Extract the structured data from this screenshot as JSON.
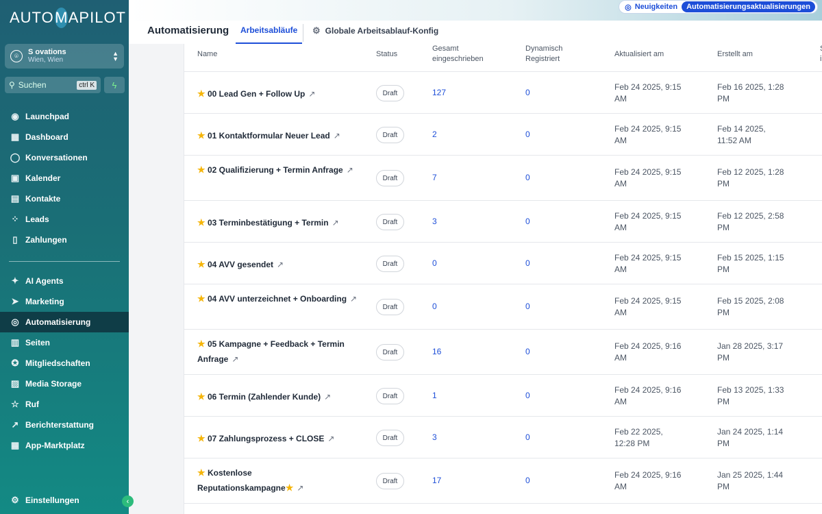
{
  "brand": {
    "logo_left": "AUTO",
    "logo_m": "M",
    "logo_right": "APILOT"
  },
  "account": {
    "name": "S          ovations",
    "sub": "Wien, Wien"
  },
  "search": {
    "placeholder": "Suchen",
    "shortcut": "ctrl K"
  },
  "sidebar": {
    "items": [
      {
        "label": "Launchpad",
        "icon": "rocket-icon",
        "glyph": "◉"
      },
      {
        "label": "Dashboard",
        "icon": "dashboard-icon",
        "glyph": "▦"
      },
      {
        "label": "Konversationen",
        "icon": "chat-icon",
        "glyph": "◯"
      },
      {
        "label": "Kalender",
        "icon": "calendar-icon",
        "glyph": "▣"
      },
      {
        "label": "Kontakte",
        "icon": "contacts-icon",
        "glyph": "▤"
      },
      {
        "label": "Leads",
        "icon": "leads-icon",
        "glyph": "⁘"
      },
      {
        "label": "Zahlungen",
        "icon": "payments-icon",
        "glyph": "▯"
      }
    ],
    "items2": [
      {
        "label": "AI Agents",
        "icon": "sparkles-icon",
        "glyph": "✦"
      },
      {
        "label": "Marketing",
        "icon": "send-icon",
        "glyph": "➤"
      },
      {
        "label": "Automatisierung",
        "icon": "automation-icon",
        "glyph": "◎"
      },
      {
        "label": "Seiten",
        "icon": "pages-icon",
        "glyph": "▥"
      },
      {
        "label": "Mitgliedschaften",
        "icon": "badge-icon",
        "glyph": "✪"
      },
      {
        "label": "Media Storage",
        "icon": "image-icon",
        "glyph": "▨"
      },
      {
        "label": "Ruf",
        "icon": "star-icon",
        "glyph": "☆"
      },
      {
        "label": "Berichterstattung",
        "icon": "trend-icon",
        "glyph": "↗"
      },
      {
        "label": "App-Marktplatz",
        "icon": "apps-icon",
        "glyph": "▦"
      }
    ],
    "settings": "Einstellungen"
  },
  "topbar": {
    "news": "Neuigkeiten",
    "updates": "Automatisierungsaktualisierungen"
  },
  "header": {
    "title": "Automatisierung",
    "tab_active": "Arbeitsabläufe",
    "tab_global": "Globale Arbeitsablauf-Konfig"
  },
  "table": {
    "columns": {
      "name": "Name",
      "status": "Status",
      "total_1": "Gesamt",
      "total_2": "eingeschrieben",
      "dyn_1": "Dynamisch",
      "dyn_2": "Registriert",
      "updated": "Aktualisiert am",
      "created": "Erstellt am",
      "extra_1": "S",
      "extra_2": "i"
    },
    "rows": [
      {
        "name": "00 Lead Gen + Follow Up",
        "status": "Draft",
        "total": "127",
        "dynamic": "0",
        "updated_1": "Feb 24 2025, 9:15",
        "updated_2": "AM",
        "created_1": "Feb 16 2025, 1:28",
        "created_2": "PM"
      },
      {
        "name": "01 Kontaktformular Neuer Lead",
        "status": "Draft",
        "total": "2",
        "dynamic": "0",
        "updated_1": "Feb 24 2025, 9:15",
        "updated_2": "AM",
        "created_1": "Feb 14 2025,",
        "created_2": "11:52 AM"
      },
      {
        "name": "02 Qualifizierung + Termin Anfrage",
        "status": "Draft",
        "total": "7",
        "dynamic": "0",
        "updated_1": "Feb 24 2025, 9:15",
        "updated_2": "AM",
        "created_1": "Feb 12 2025, 1:28",
        "created_2": "PM"
      },
      {
        "name": "03 Terminbestätigung + Termin",
        "status": "Draft",
        "total": "3",
        "dynamic": "0",
        "updated_1": "Feb 24 2025, 9:15",
        "updated_2": "AM",
        "created_1": "Feb 12 2025, 2:58",
        "created_2": "PM"
      },
      {
        "name": "04 AVV gesendet",
        "status": "Draft",
        "total": "0",
        "dynamic": "0",
        "updated_1": "Feb 24 2025, 9:15",
        "updated_2": "AM",
        "created_1": "Feb 15 2025, 1:15",
        "created_2": "PM"
      },
      {
        "name": "04 AVV unterzeichnet + Onboarding",
        "status": "Draft",
        "total": "0",
        "dynamic": "0",
        "updated_1": "Feb 24 2025, 9:15",
        "updated_2": "AM",
        "created_1": "Feb 15 2025, 2:08",
        "created_2": "PM"
      },
      {
        "name": "05 Kampagne + Feedback + Termin Anfrage",
        "status": "Draft",
        "total": "16",
        "dynamic": "0",
        "updated_1": "Feb 24 2025, 9:16",
        "updated_2": "AM",
        "created_1": "Jan 28 2025, 3:17",
        "created_2": "PM"
      },
      {
        "name": "06 Termin (Zahlender Kunde)",
        "status": "Draft",
        "total": "1",
        "dynamic": "0",
        "updated_1": "Feb 24 2025, 9:16",
        "updated_2": "AM",
        "created_1": "Feb 13 2025, 1:33",
        "created_2": "PM"
      },
      {
        "name": "07 Zahlungsprozess + CLOSE",
        "status": "Draft",
        "total": "3",
        "dynamic": "0",
        "updated_1": "Feb 22 2025,",
        "updated_2": "12:28 PM",
        "created_1": "Jan 24 2025, 1:14",
        "created_2": "PM"
      },
      {
        "name": "Kostenlose Reputationskampagne",
        "status": "Draft",
        "total": "17",
        "dynamic": "0",
        "updated_1": "Feb 24 2025, 9:16",
        "updated_2": "AM",
        "created_1": "Jan 25 2025, 1:44",
        "created_2": "PM"
      }
    ]
  },
  "colors": {
    "accent": "#1d4ed8",
    "sidebar_top": "#1f5f73",
    "sidebar_bottom": "#138a84",
    "star": "#f5b50a",
    "toggle": "#2dbb7c"
  }
}
